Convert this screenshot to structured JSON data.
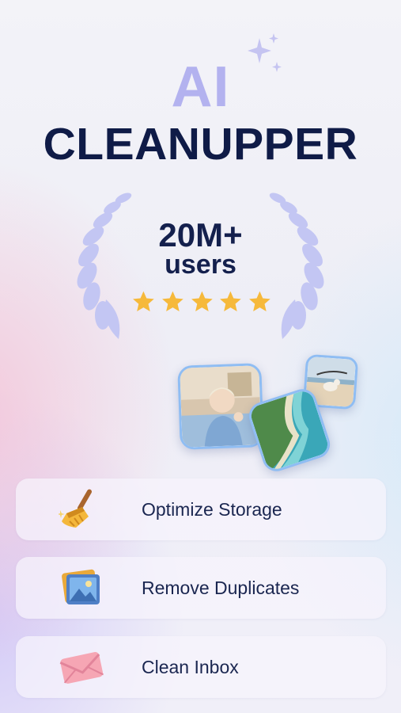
{
  "header": {
    "title_ai": "AI",
    "title_main": "CLEANUPPER",
    "sparkle_icon": "sparkle-icon"
  },
  "rating": {
    "users_count": "20M+",
    "users_label": "users",
    "stars": 5,
    "star_color": "#f6b93b"
  },
  "photos": [
    {
      "icon": "selfie-photo"
    },
    {
      "icon": "coastline-photo"
    },
    {
      "icon": "beach-dog-photo"
    }
  ],
  "features": [
    {
      "label": "Optimize Storage",
      "icon": "broom-icon"
    },
    {
      "label": "Remove Duplicates",
      "icon": "duplicate-photos-icon"
    },
    {
      "label": "Clean Inbox",
      "icon": "envelope-icon"
    }
  ],
  "colors": {
    "accent_light": "#b3b2ef",
    "navy": "#0f1b47",
    "laurel": "#c3c6f3"
  }
}
